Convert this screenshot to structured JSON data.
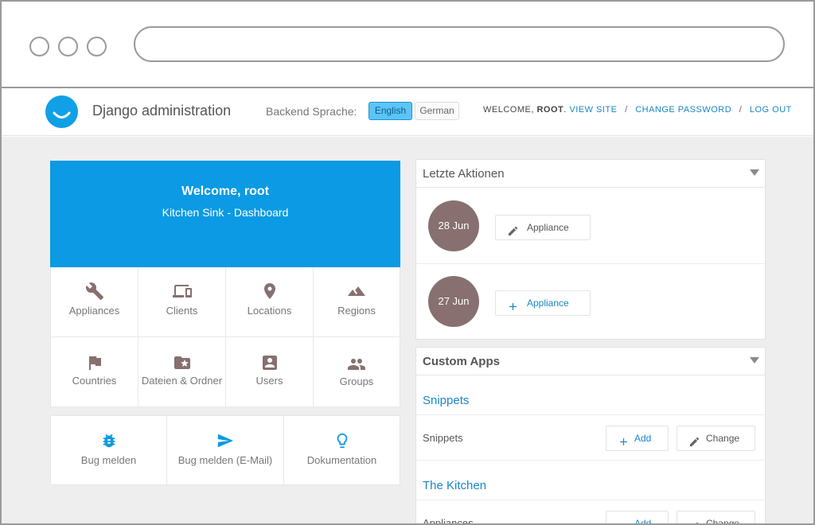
{
  "header": {
    "site_title": "Django administration",
    "language_label": "Backend Sprache:",
    "languages": [
      "English",
      "German"
    ],
    "active_language": "English",
    "welcome_prefix": "WELCOME,",
    "username": "ROOT",
    "links": [
      "VIEW SITE",
      "CHANGE PASSWORD",
      "LOG OUT"
    ],
    "separator": "/"
  },
  "welcome": {
    "title": "Welcome, root",
    "subtitle": "Kitchen Sink - Dashboard"
  },
  "models": [
    {
      "label": "Appliances",
      "icon": "wrench-icon"
    },
    {
      "label": "Clients",
      "icon": "devices-icon"
    },
    {
      "label": "Locations",
      "icon": "location-pin-icon"
    },
    {
      "label": "Regions",
      "icon": "landscape-icon"
    },
    {
      "label": "Countries",
      "icon": "flag-icon"
    },
    {
      "label": "Dateien & Ordner",
      "icon": "folder-star-icon"
    },
    {
      "label": "Users",
      "icon": "account-box-icon"
    },
    {
      "label": "Groups",
      "icon": "group-icon"
    }
  ],
  "quick_links": [
    {
      "label": "Bug melden",
      "icon": "bug-icon"
    },
    {
      "label": "Bug melden (E-Mail)",
      "icon": "send-icon"
    },
    {
      "label": "Dokumentation",
      "icon": "lightbulb-icon"
    }
  ],
  "recent_actions": {
    "title": "Letzte Aktionen",
    "items": [
      {
        "date": "28 Jun",
        "label": "Appliance",
        "action": "edit",
        "icon": "pencil-icon"
      },
      {
        "date": "27 Jun",
        "label": "Appliance",
        "action": "add",
        "icon": "plus-icon"
      }
    ]
  },
  "custom_apps": {
    "title": "Custom Apps",
    "add_label": "Add",
    "change_label": "Change",
    "apps": [
      {
        "title": "Snippets",
        "models": [
          "Snippets"
        ]
      },
      {
        "title": "The Kitchen",
        "models": [
          "Appliances"
        ]
      }
    ]
  },
  "colors": {
    "accent": "#0b9ae3",
    "link": "#1a86c8",
    "date_circle": "#87706f",
    "icon": "#87706f",
    "background": "#eeeeee"
  }
}
